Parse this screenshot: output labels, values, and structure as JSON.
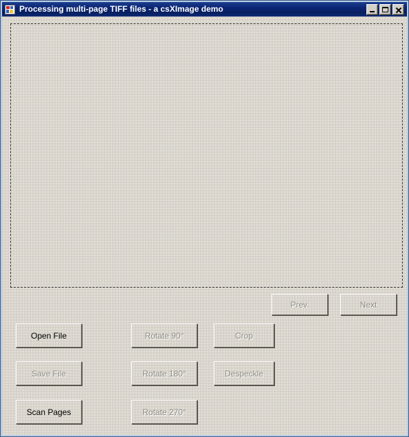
{
  "window": {
    "title": "Processing multi-page TIFF files - a csXImage demo",
    "icon": "app-tiles-icon",
    "controls": {
      "minimize": "minimize-icon",
      "maximize": "maximize-icon",
      "close": "close-icon"
    }
  },
  "colors": {
    "titlebar_start": "#1b3f8f",
    "titlebar_end": "#082060",
    "titlebar_frame": "#b8cce4",
    "client_background": "#d7d4cb",
    "button_face": "#d7d4cb",
    "text_enabled": "#000000",
    "text_disabled": "#8e8b84",
    "dashed_border": "#333333"
  },
  "preview": {
    "name": "image-preview-area",
    "content": "",
    "border_style": "dashed"
  },
  "navigation": {
    "prev": {
      "label": "Prev.",
      "enabled": false
    },
    "next": {
      "label": "Next",
      "enabled": false
    }
  },
  "file_actions": [
    {
      "label": "Open File",
      "enabled": true
    },
    {
      "label": "Save File",
      "enabled": false
    },
    {
      "label": "Scan Pages",
      "enabled": true
    }
  ],
  "rotate_actions": [
    {
      "label": "Rotate 90°",
      "enabled": false
    },
    {
      "label": "Rotate 180°",
      "enabled": false
    },
    {
      "label": "Rotate 270°",
      "enabled": false
    }
  ],
  "image_actions": [
    {
      "label": "Crop",
      "enabled": false
    },
    {
      "label": "Despeckle",
      "enabled": false
    }
  ]
}
